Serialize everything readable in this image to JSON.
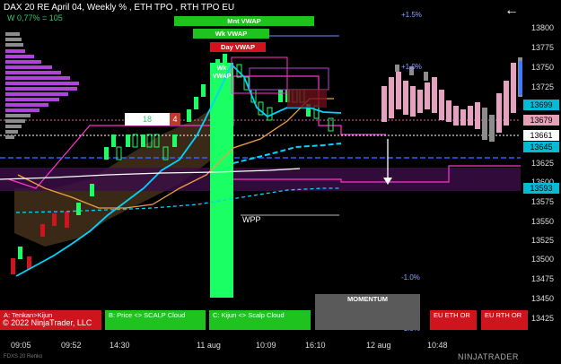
{
  "header": {
    "title": "DAX 20  RE April 04, Weekly % , ETH TPO , RTH TPO EU",
    "subtitle": "W 0,77% = 105",
    "back_label": "←"
  },
  "y_axis": {
    "labels": [
      "13800",
      "13775",
      "13750",
      "13725",
      "13625",
      "13600",
      "13575",
      "13550",
      "13525",
      "13500",
      "13475",
      "13450",
      "13425"
    ],
    "highlights": [
      {
        "label": "13699",
        "color": "#00bcd4"
      },
      {
        "label": "13679",
        "color": "#e8a0b8"
      },
      {
        "label": "13661",
        "color": "#ffffff"
      },
      {
        "label": "13645",
        "color": "#00bcd4"
      },
      {
        "label": "13593",
        "color": "#00bcd4"
      }
    ]
  },
  "x_axis": {
    "labels": [
      "09:05",
      "09:52",
      "14:30",
      "11 aug",
      "10:09",
      "16:10",
      "12 aug",
      "10:48"
    ]
  },
  "percent_labels": [
    "+1.5%",
    "+1.0%",
    "-1.0%",
    "-1.5%"
  ],
  "vwap_labels": {
    "monthly": "Mnt VWAP",
    "weekly": "Wk VWAP",
    "daily": "Day VWAP",
    "weekly_inline": "Wk VWAP"
  },
  "boxes": {
    "green_value": "18",
    "red_value": "4"
  },
  "annotations": {
    "wpp": "WPP"
  },
  "panels": [
    {
      "label": "A: Tenkan>Kijun",
      "color": "#d0141e"
    },
    {
      "label": "B: Price <> SCALP Cloud",
      "color": "#1fc31f"
    },
    {
      "label": "C: Kijun <> Scalp Cloud",
      "color": "#1fc31f"
    }
  ],
  "momentum": {
    "label": "MOMENTUM"
  },
  "eu_buttons": [
    {
      "label": "EU ETH OR",
      "color": "#d0141e"
    },
    {
      "label": "EU RTH OR",
      "color": "#d0141e"
    }
  ],
  "footer": {
    "copyright": "© 2022 NinjaTrader, LLC",
    "left_note": "FDXS 20 Renko",
    "brand": "NINJATRADER"
  },
  "colors": {
    "background": "#000000",
    "up_candle": "#1aff63",
    "down_candle": "#d0141e",
    "tpo_purple": "#b044d8",
    "tpo_gray": "#8c8c8c",
    "tpo_pink": "#e8a0c0",
    "cyan": "#00d5ff",
    "orange": "#f0a040",
    "magenta": "#ff33cc",
    "blue_dash": "#3060ff"
  }
}
